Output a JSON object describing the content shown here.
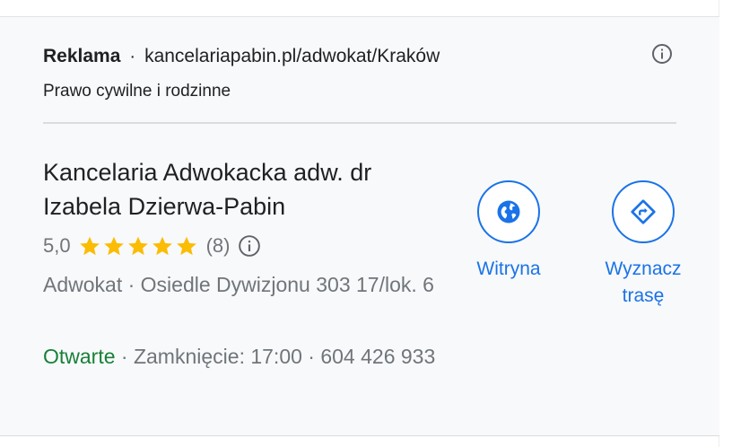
{
  "ad": {
    "label": "Reklama",
    "separator": "·",
    "url": "kancelariapabin.pl/adwokat/Kraków",
    "subtitle": "Prawo cywilne i rodzinne"
  },
  "business": {
    "name": "Kancelaria Adwokacka adw. dr Izabela Dzierwa-Pabin",
    "rating": "5,0",
    "stars": 5,
    "review_count": "(8)",
    "address": "Adwokat · Osiedle Dywizjonu 303 17/lok. 6",
    "status": "Otwarte",
    "hours_rest": " · Zamknięcie: 17:00 · 604 426 933"
  },
  "actions": {
    "website_label": "Witryna",
    "directions_label": "Wyznacz trasę"
  },
  "colors": {
    "accent": "#1a73e8",
    "open_green": "#188038",
    "star": "#fbbc04",
    "muted_text": "#70757a"
  },
  "icons": {
    "info": "info-icon",
    "star": "star-icon",
    "website": "globe-icon",
    "directions": "directions-icon"
  }
}
